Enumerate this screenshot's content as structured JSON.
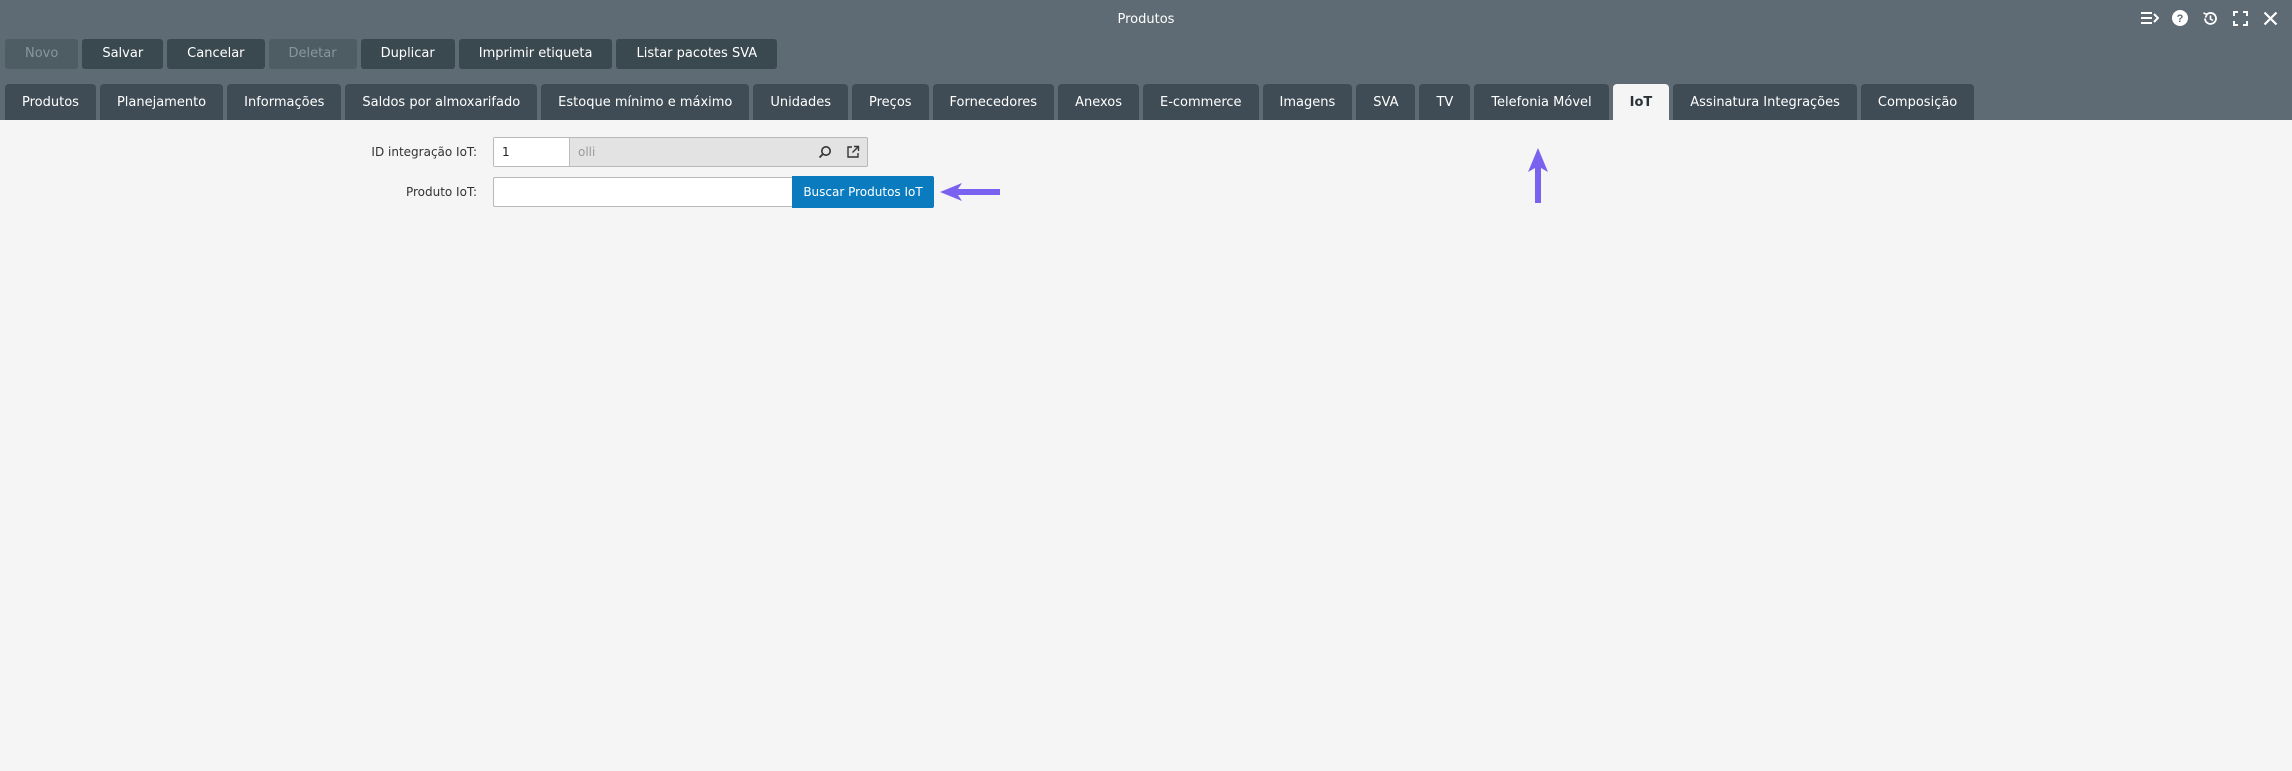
{
  "window": {
    "title": "Produtos",
    "icons": [
      "list-toggle-icon",
      "help-icon",
      "history-icon",
      "fullscreen-icon",
      "close-icon"
    ]
  },
  "toolbar": {
    "buttons": [
      {
        "label": "Novo",
        "disabled": true
      },
      {
        "label": "Salvar",
        "disabled": false
      },
      {
        "label": "Cancelar",
        "disabled": false
      },
      {
        "label": "Deletar",
        "disabled": true
      },
      {
        "label": "Duplicar",
        "disabled": false
      },
      {
        "label": "Imprimir etiqueta",
        "disabled": false
      },
      {
        "label": "Listar pacotes SVA",
        "disabled": false
      }
    ]
  },
  "tabs": [
    "Produtos",
    "Planejamento",
    "Informações",
    "Saldos por almoxarifado",
    "Estoque mínimo e máximo",
    "Unidades",
    "Preços",
    "Fornecedores",
    "Anexos",
    "E-commerce",
    "Imagens",
    "SVA",
    "TV",
    "Telefonia Móvel",
    "IoT",
    "Assinatura Integrações",
    "Composição"
  ],
  "active_tab": "IoT",
  "form": {
    "id_integracao": {
      "label": "ID integração IoT:",
      "code": "1",
      "description": "olli"
    },
    "produto_iot": {
      "label": "Produto IoT:",
      "value": "",
      "button": "Buscar Produtos IoT"
    }
  },
  "colors": {
    "header": "#5e6b74",
    "button": "#3a4850",
    "tab": "#3f4c55",
    "primary": "#0b7bbf",
    "annotation_arrow": "#7b61f0"
  }
}
